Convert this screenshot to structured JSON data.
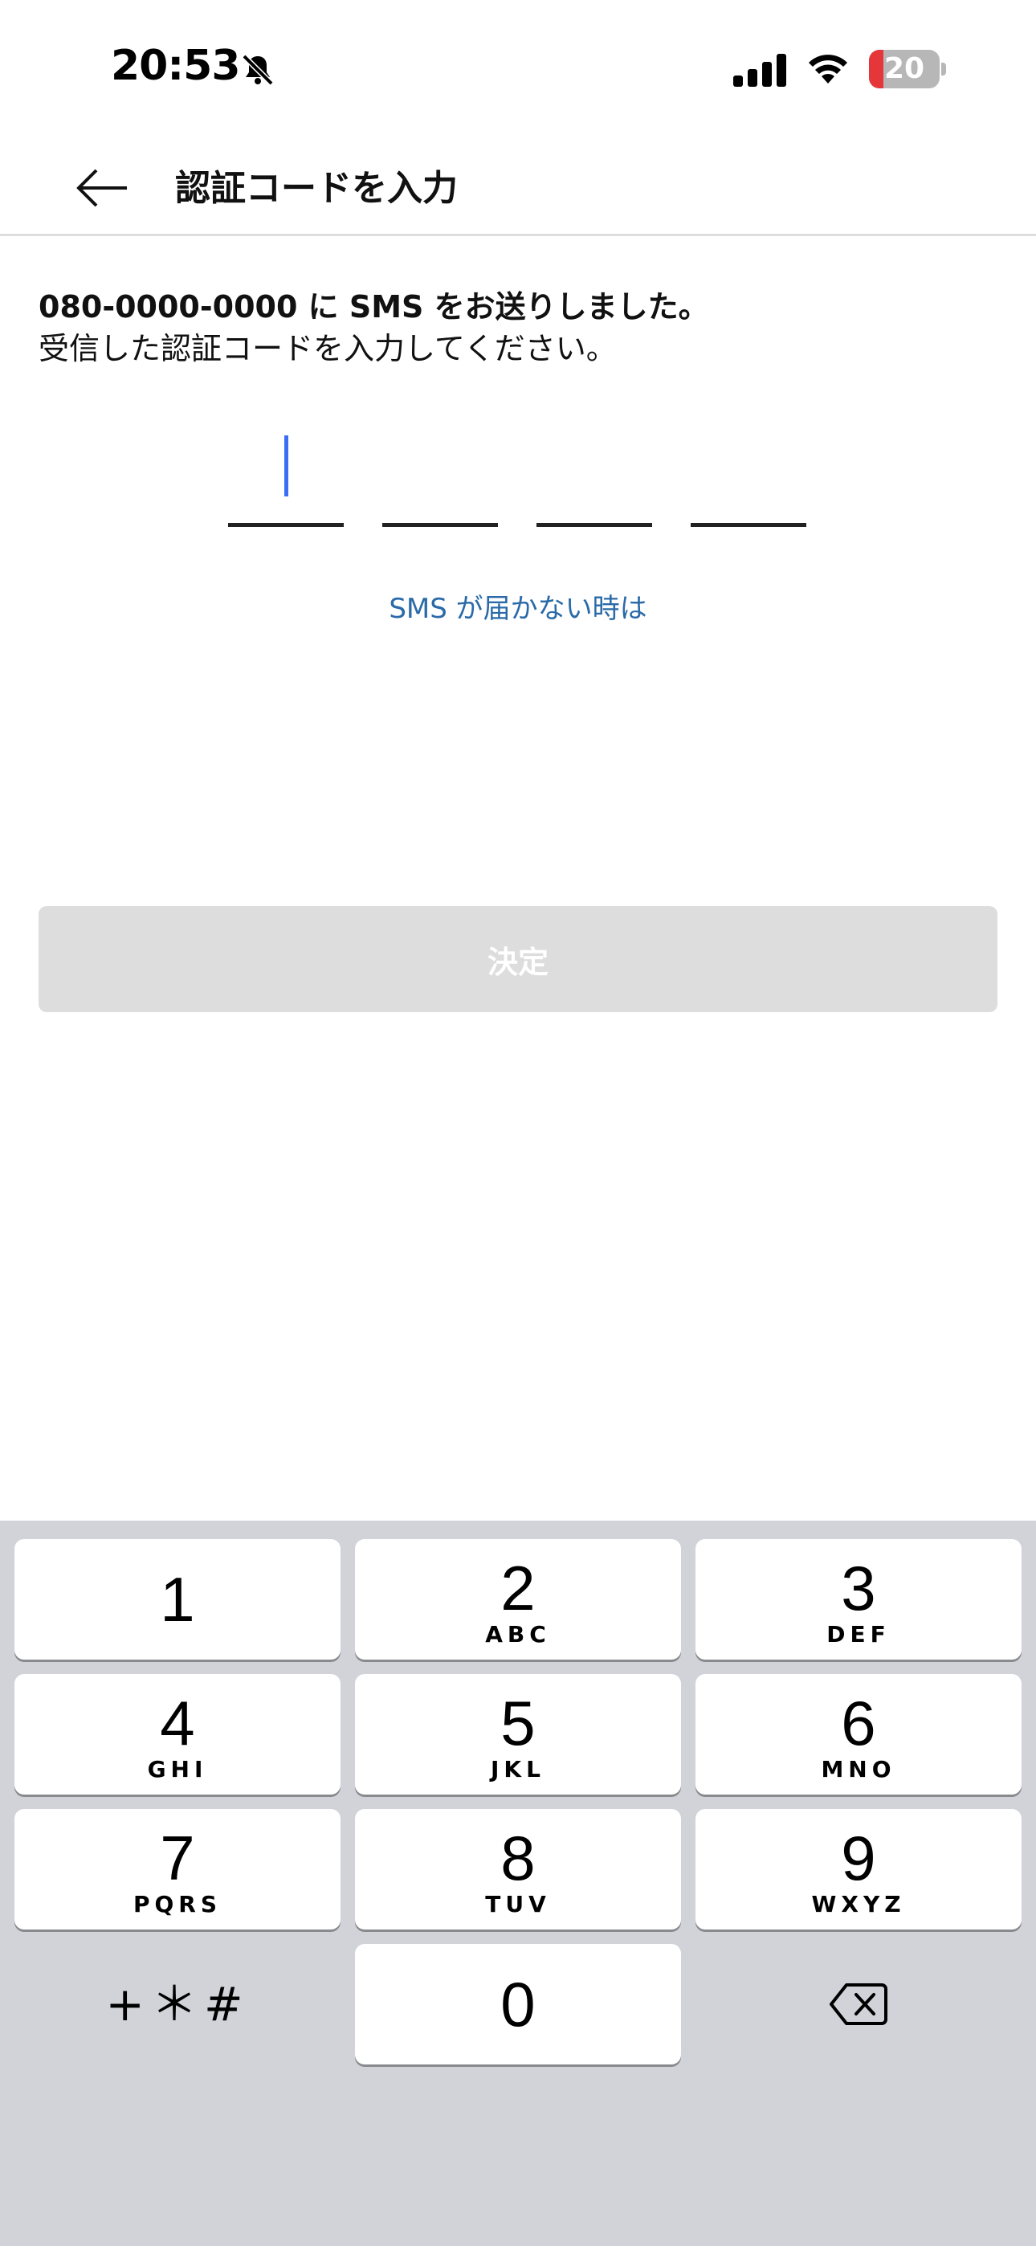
{
  "status_bar": {
    "time": "20:53",
    "battery_level": "20",
    "battery_fraction": 0.2,
    "icons": [
      "bell-slash-icon",
      "cellular-signal-icon",
      "wifi-icon",
      "battery-icon"
    ]
  },
  "header": {
    "title": "認証コードを入力",
    "back_icon": "arrow-left-icon"
  },
  "message": {
    "line1": "080-0000-0000 に SMS をお送りしました。",
    "line2": "受信した認証コードを入力してください。"
  },
  "code_input": {
    "digits": [
      "",
      "",
      "",
      ""
    ],
    "caret_color": "#3b6ef5"
  },
  "help_link": "SMS が届かない時は",
  "submit_button": "決定",
  "keypad": {
    "keys": [
      {
        "digit": "1",
        "letters": ""
      },
      {
        "digit": "2",
        "letters": "ABC"
      },
      {
        "digit": "3",
        "letters": "DEF"
      },
      {
        "digit": "4",
        "letters": "GHI"
      },
      {
        "digit": "5",
        "letters": "JKL"
      },
      {
        "digit": "6",
        "letters": "MNO"
      },
      {
        "digit": "7",
        "letters": "PQRS"
      },
      {
        "digit": "8",
        "letters": "TUV"
      },
      {
        "digit": "9",
        "letters": "WXYZ"
      },
      {
        "digit": "0",
        "letters": ""
      }
    ],
    "symbols_key": "+＊#",
    "delete_icon": "backspace-icon"
  },
  "colors": {
    "link": "#2a6aa8",
    "button_disabled": "#dddddd",
    "keyboard_bg": "#d1d3d9",
    "battery_low": "#e5363a"
  }
}
